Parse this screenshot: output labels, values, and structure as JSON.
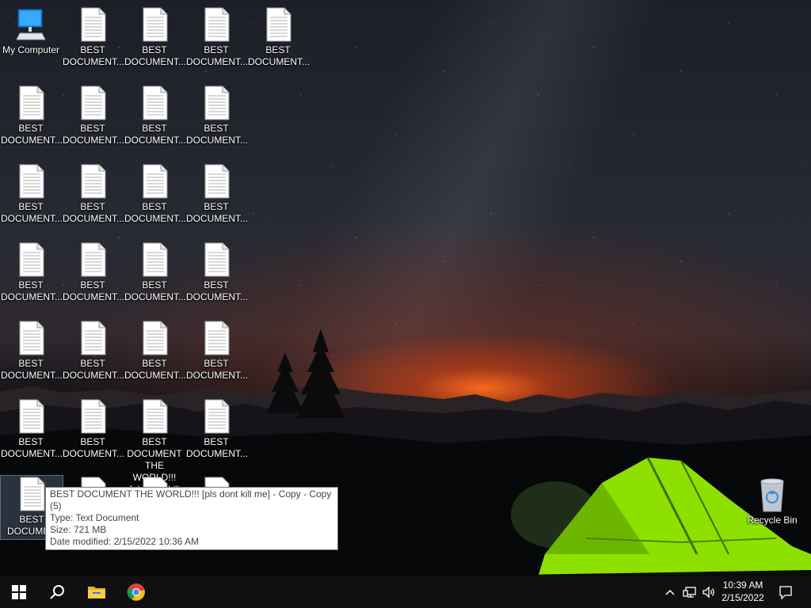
{
  "desktop": {
    "my_computer_label": "My Computer",
    "recycle_bin_label": "Recycle Bin",
    "doc_label_truncated": "BEST DOCUMENT...",
    "doc_label_line1": "BEST",
    "doc_label_line2": "DOCUMENT...",
    "special_doc_lines": [
      "BEST",
      "DOCUMENT",
      "THE WORLD!!!",
      "[pls dont kill"
    ],
    "selected_doc_lines": [
      "BEST",
      "DOCUMEN"
    ]
  },
  "tooltip": {
    "name": "BEST DOCUMENT THE WORLD!!! [pls dont kill me] - Copy - Copy (5)",
    "type": "Type: Text Document",
    "size": "Size: 721 MB",
    "date_modified": "Date modified: 2/15/2022 10:36 AM"
  },
  "taskbar": {
    "start": "start-icon",
    "search": "search-icon",
    "file_explorer": "folder-icon",
    "browser": "chrome-icon",
    "tray_chevron": "chevron-up-icon",
    "network": "network-icon",
    "volume": "volume-icon",
    "notifications": "notification-icon"
  },
  "clock": {
    "time": "10:39 AM",
    "date": "2/15/2022"
  },
  "colors": {
    "taskbar": "#101012",
    "tent": "#8ee000",
    "horizon": "#ff6a1e",
    "tooltip_border": "#767676"
  }
}
